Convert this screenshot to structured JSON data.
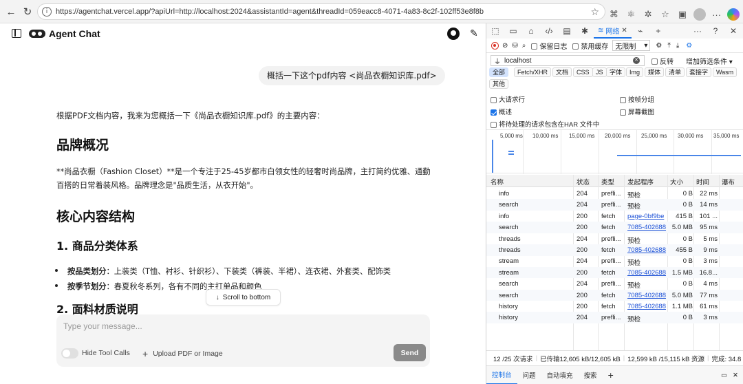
{
  "browser": {
    "url": "https://agentchat.vercel.app/?apiUrl=http://localhost:2024&assistantId=agent&threadId=059eacc8-4071-4a83-8c2f-102ff53e8f8b",
    "chat_label": "聊天"
  },
  "app": {
    "title": "Agent Chat",
    "user_message": "概括一下这个pdf内容 <尚品衣橱知识库.pdf>",
    "answer": {
      "intro": "根据PDF文档内容，我来为您概括一下《尚品衣橱知识库.pdf》的主要内容：",
      "h_brand": "品牌概况",
      "brand_line1": "**尚品衣橱（Fashion Closet）**是一个专注于25-45岁都市白领女性的轻奢时尚品牌，主打简约优雅、通勤",
      "brand_line2": "百搭的日常着装风格。品牌理念是\"品质生活，从衣开始\"。",
      "h_structure": "核心内容结构",
      "h_category": "1. 商品分类体系",
      "bullet1_label": "按品类划分",
      "bullet1_text": "：上装类（T恤、衬衫、针织衫）、下装类（裤装、半裙）、连衣裙、外套类、配饰类",
      "bullet2_label": "按季节划分",
      "bullet2_text": "：春夏秋冬系列，各有不同的主打单品和颜色",
      "h_fabric": "2. 面料材质说明"
    },
    "scroll_label": "Scroll to bottom",
    "composer": {
      "placeholder": "Type your message...",
      "hide_tool_calls": "Hide Tool Calls",
      "upload": "Upload PDF or Image",
      "send": "Send"
    }
  },
  "devtools": {
    "network_tab": "网络",
    "preserve_log": "保留日志",
    "disable_cache": "禁用缓存",
    "throttle": "无限制",
    "filter_value": "localhost",
    "invert": "反转",
    "more_filters": "增加筛选条件",
    "chips": [
      "全部",
      "Fetch/XHR",
      "文档",
      "CSS",
      "JS",
      "字体",
      "Img",
      "媒体",
      "清单",
      "套接字",
      "Wasm",
      "其他"
    ],
    "options": {
      "big_rows": "大请求行",
      "group_by_frame": "按帧分组",
      "overview": "概述",
      "screenshots": "屏幕截图",
      "har": "将待处理的请求包含在HAR 文件中"
    },
    "timeline_ticks": [
      "5,000 ms",
      "10,000 ms",
      "15,000 ms",
      "20,000 ms",
      "25,000 ms",
      "30,000 ms",
      "35,000 ms"
    ],
    "columns": [
      "名称",
      "状态",
      "类型",
      "发起程序",
      "大小",
      "时间",
      "瀑布"
    ],
    "rows": [
      {
        "name": "info",
        "status": "204",
        "type": "prefli...",
        "initiator": "预检",
        "size": "0 B",
        "time": "22 ms"
      },
      {
        "name": "search",
        "status": "204",
        "type": "prefli...",
        "initiator": "预检",
        "size": "0 B",
        "time": "14 ms"
      },
      {
        "name": "info",
        "status": "200",
        "type": "fetch",
        "initiator": "page-0bf9be",
        "size": "415 B",
        "time": "101 ..."
      },
      {
        "name": "search",
        "status": "200",
        "type": "fetch",
        "initiator": "7085-402688",
        "size": "5.0 MB",
        "time": "95 ms"
      },
      {
        "name": "threads",
        "status": "204",
        "type": "prefli...",
        "initiator": "预检",
        "size": "0 B",
        "time": "5 ms"
      },
      {
        "name": "threads",
        "status": "200",
        "type": "fetch",
        "initiator": "7085-402688",
        "size": "455 B",
        "time": "9 ms"
      },
      {
        "name": "stream",
        "status": "204",
        "type": "prefli...",
        "initiator": "预检",
        "size": "0 B",
        "time": "3 ms"
      },
      {
        "name": "stream",
        "status": "200",
        "type": "fetch",
        "initiator": "7085-402688",
        "size": "1.5 MB",
        "time": "16.8..."
      },
      {
        "name": "search",
        "status": "204",
        "type": "prefli...",
        "initiator": "预检",
        "size": "0 B",
        "time": "4 ms"
      },
      {
        "name": "search",
        "status": "200",
        "type": "fetch",
        "initiator": "7085-402688",
        "size": "5.0 MB",
        "time": "77 ms"
      },
      {
        "name": "history",
        "status": "200",
        "type": "fetch",
        "initiator": "7085-402688",
        "size": "1.1 MB",
        "time": "61 ms"
      },
      {
        "name": "history",
        "status": "204",
        "type": "prefli...",
        "initiator": "预检",
        "size": "0 B",
        "time": "3 ms"
      }
    ],
    "summary": {
      "requests": "12 /25 次请求",
      "transferred": "已传输12,605 kB/12,605 kB",
      "resources": "12,599 kB /15,115 kB 资源",
      "finish": "完成: 34.8"
    },
    "drawer_tabs": [
      "控制台",
      "问题",
      "自动填充",
      "搜索"
    ]
  }
}
